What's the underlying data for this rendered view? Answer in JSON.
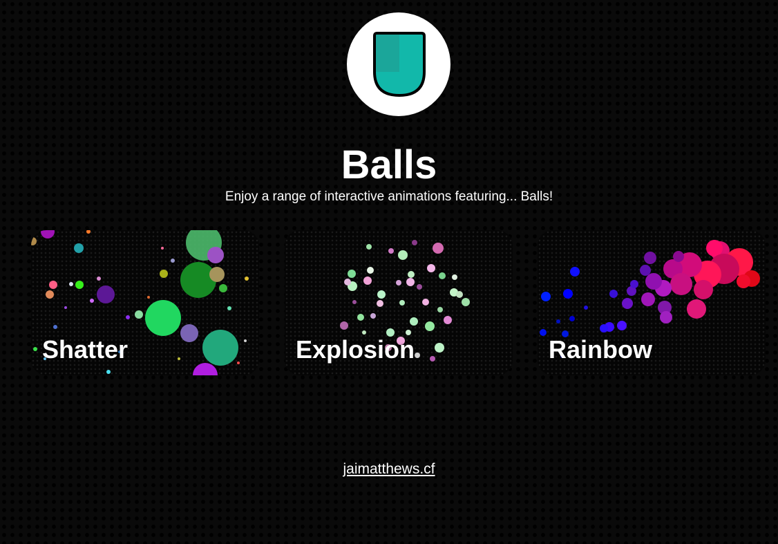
{
  "header": {
    "title": "Balls",
    "subtitle": "Enjoy a range of interactive animations featuring... Balls!",
    "logo_icon": "shield-icon",
    "logo_color": "#12b8aa"
  },
  "cards": [
    {
      "label": "Shatter"
    },
    {
      "label": "Explosion"
    },
    {
      "label": "Rainbow"
    }
  ],
  "footer": {
    "link_text": "jaimatthews.cf"
  }
}
